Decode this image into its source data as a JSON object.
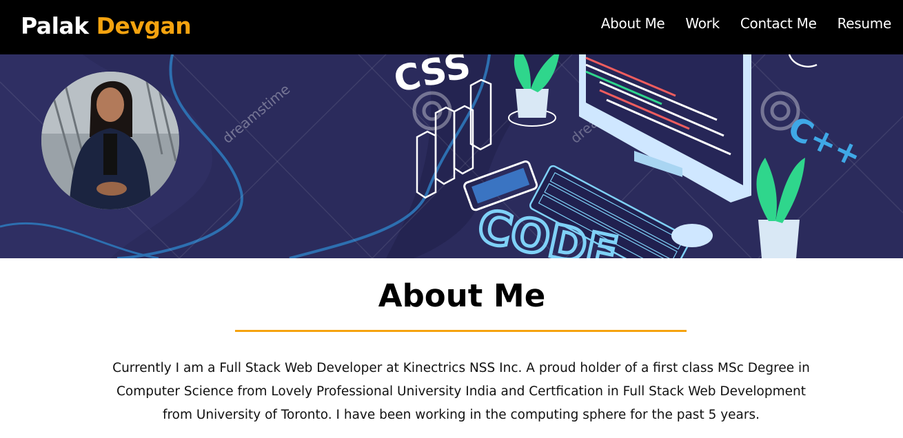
{
  "navbar": {
    "brand_first": "Palak",
    "brand_last": "Devgan",
    "links": [
      "About Me",
      "Work",
      "Contact Me",
      "Resume"
    ]
  },
  "hero": {
    "watermark": "dreamstime",
    "icons": [
      "css-text",
      "bar-chart",
      "plant-pot",
      "desktop-monitor",
      "smartphone",
      "keyboard",
      "mouse",
      "cpp-text",
      "code-text"
    ],
    "avatar": "profile-photo"
  },
  "about": {
    "title": "About Me",
    "text": "Currently I am a Full Stack Web Developer at Kinectrics NSS Inc. A proud holder of a first class MSc Degree in Computer Science from Lovely Professional University India and Certfication in Full Stack Web Development from University of Toronto. I have been working in the computing sphere for the past 5 years."
  },
  "colors": {
    "navbar_bg": "#000000",
    "accent": "#f5a30f",
    "hero_bg": "#2b2b5c"
  }
}
